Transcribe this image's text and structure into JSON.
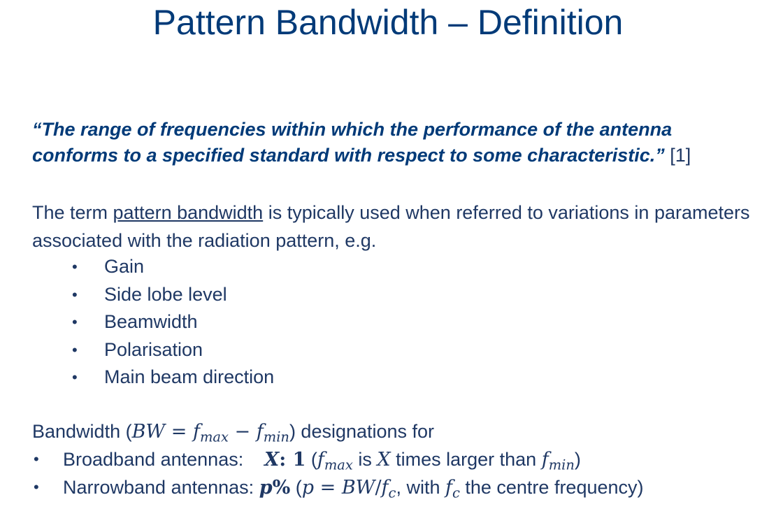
{
  "title": "Pattern Bandwidth – Definition",
  "quote": {
    "text": "“The range of frequencies within which the performance of the antenna conforms to a specified standard with respect to some characteristic.”",
    "reference": "[1]"
  },
  "intro": {
    "before": "The term ",
    "underlined": "pattern bandwidth",
    "after": " is typically used when referred to variations in parameters associated with the radiation pattern, e.g."
  },
  "bullets": [
    "Gain",
    "Side lobe level",
    "Beamwidth",
    "Polarisation",
    "Main beam direction"
  ],
  "bandwidth": {
    "prefix": "Bandwidth (",
    "bw_symbol": "BW",
    "equals": " = ",
    "f": "f",
    "max": "max",
    "minus": " − ",
    "min": "min",
    "suffix": ") designations for",
    "broadband_label": "Broadband antennas:",
    "broadband_x": "X",
    "broadband_colon": ": ",
    "broadband_one": "1",
    "broadband_open": " (",
    "broadband_is": " is ",
    "broadband_x2": "X",
    "broadband_times": " times larger than ",
    "broadband_close": ")",
    "narrowband_label": "Narrowband antennas:",
    "narrowband_p": "p",
    "narrowband_pct": "%",
    "narrowband_open": " (",
    "narrowband_p2": "p",
    "narrowband_eq": " = ",
    "narrowband_bw": "BW",
    "narrowband_slash": "/",
    "narrowband_c": "c",
    "narrowband_with": ", with ",
    "narrowband_centre": " the centre frequency)"
  }
}
